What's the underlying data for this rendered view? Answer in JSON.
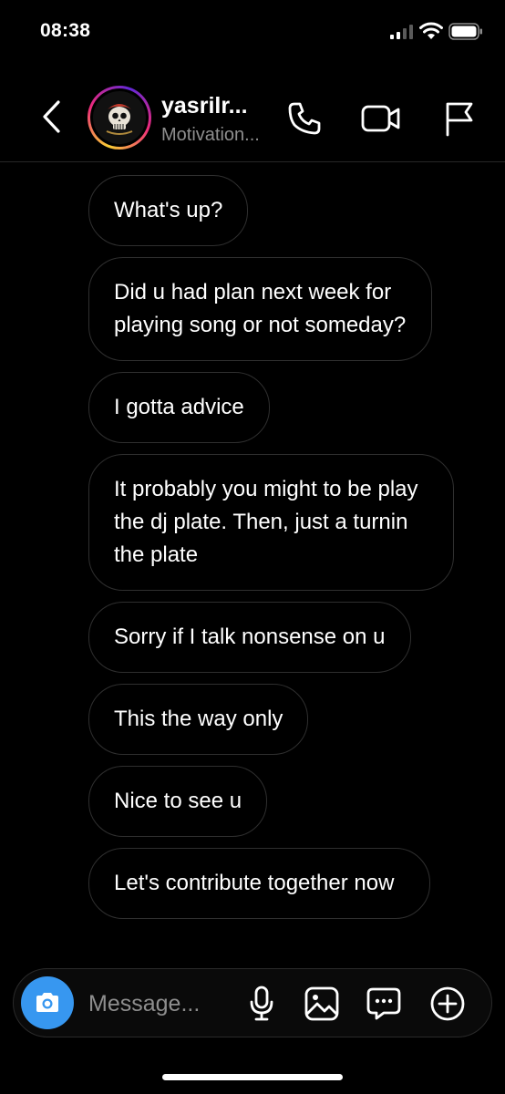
{
  "status_bar": {
    "time": "08:38"
  },
  "header": {
    "username": "yasrilr...",
    "subtitle": "Motivation..."
  },
  "messages": [
    "What's up?",
    "Did u had plan next week for playing song or not someday?",
    "I gotta advice",
    "It probably you might to be play the dj plate. Then, just a turnin the plate",
    "Sorry if I talk nonsense on u",
    "This the way only",
    "Nice to see u",
    "Let's contribute together now"
  ],
  "composer": {
    "placeholder": "Message..."
  },
  "colors": {
    "background": "#000000",
    "bubble_border": "#2f2f2f",
    "camera_button": "#3797f0",
    "muted_text": "#8e8e8e"
  },
  "icons": [
    "back-icon",
    "avatar",
    "phone-icon",
    "video-icon",
    "flag-icon",
    "camera-icon",
    "mic-icon",
    "gallery-icon",
    "sticker-icon",
    "plus-icon"
  ]
}
